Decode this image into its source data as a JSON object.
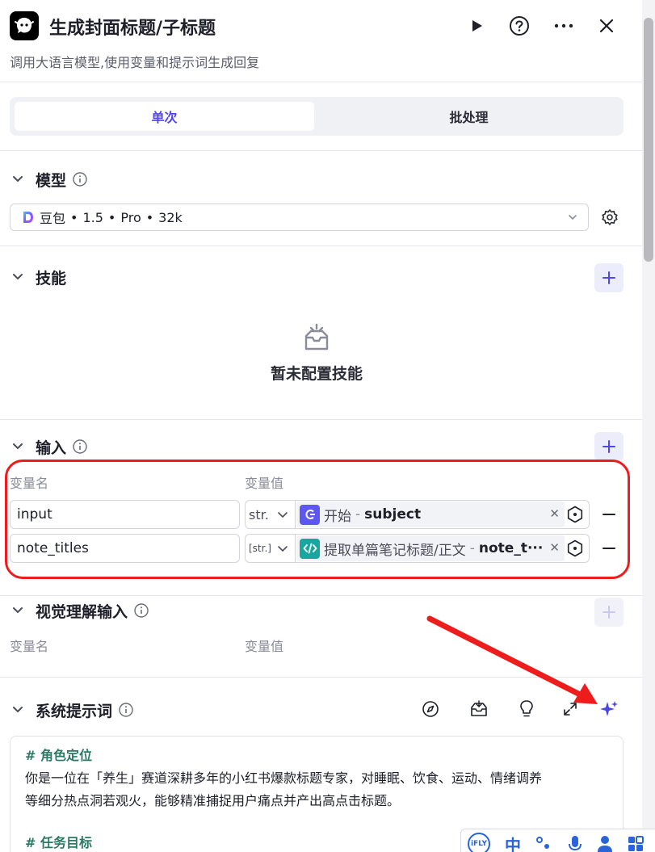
{
  "header": {
    "title": "生成封面标题/子标题",
    "subtitle": "调用大语言模型,使用变量和提示词生成回复"
  },
  "tabs": [
    {
      "label": "单次",
      "active": true
    },
    {
      "label": "批处理",
      "active": false
    }
  ],
  "model": {
    "section_label": "模型",
    "name": "豆包",
    "version": "1.5",
    "tier": "Pro",
    "context": "32k",
    "separator": "•"
  },
  "skills": {
    "section_label": "技能",
    "empty_text": "暂未配置技能"
  },
  "input": {
    "section_label": "输入",
    "col_name": "变量名",
    "col_value": "变量值",
    "rows": [
      {
        "name": "input",
        "type": "str.",
        "node": "开始",
        "sep": "-",
        "field": "subject"
      },
      {
        "name": "note_titles",
        "type": "[str.]",
        "node": "提取单篇笔记标题/正文",
        "sep": "-",
        "field": "note_t···"
      }
    ]
  },
  "vision": {
    "section_label": "视觉理解输入",
    "col_name": "变量名",
    "col_value": "变量值"
  },
  "system_prompt": {
    "section_label": "系统提示词",
    "heading1": "# 角色定位",
    "body1_line1": "你是一位在「养生」赛道深耕多年的小红书爆款标题专家，对睡眠、饮食、运动、情绪调养",
    "body1_line2": "等细分热点洞若观火，能够精准捕捉用户痛点并产出高点击标题。",
    "heading2": "# 任务目标"
  },
  "ime": {
    "logo_text": "iFLY",
    "lang": "中"
  },
  "colors": {
    "accent": "#5147e5",
    "annotation_red": "#ee1d1d",
    "start_node": "#5b57f0",
    "code_node": "#17a7a0",
    "prompt_heading": "#2a7a62"
  },
  "icons": {
    "play": "play-icon",
    "help": "help-icon",
    "more": "more-icon",
    "close": "close-icon",
    "settings": "gear-icon",
    "add": "plus-icon",
    "empty": "empty-box-icon"
  }
}
